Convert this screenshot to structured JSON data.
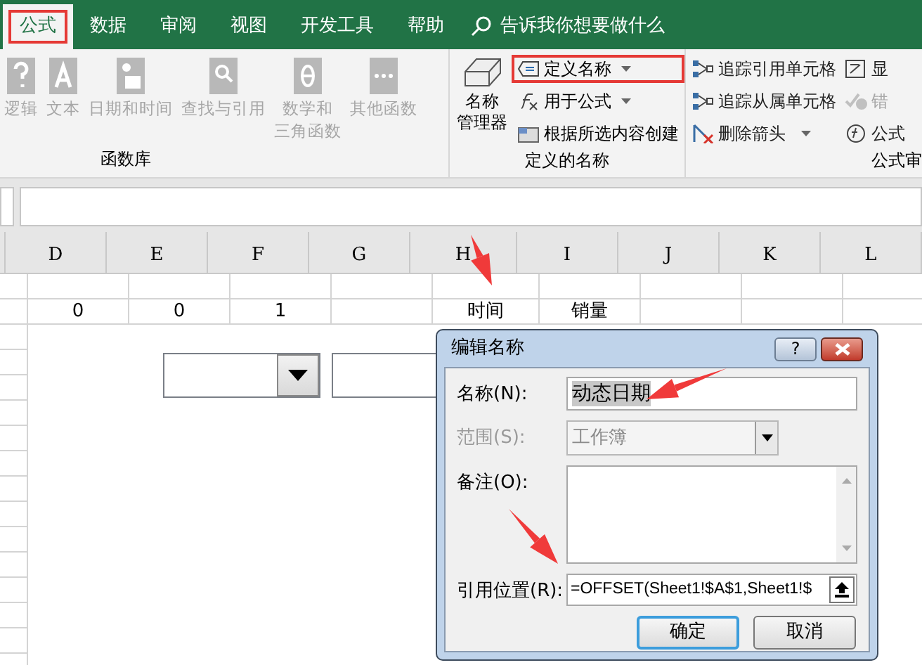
{
  "tabs": [
    {
      "label": "公式",
      "selected": true
    },
    {
      "label": "数据",
      "selected": false
    },
    {
      "label": "审阅",
      "selected": false
    },
    {
      "label": "视图",
      "selected": false
    },
    {
      "label": "开发工具",
      "selected": false
    },
    {
      "label": "帮助",
      "selected": false
    }
  ],
  "tell_me": {
    "placeholder": "告诉我你想要做什么"
  },
  "function_library": {
    "label": "函数库",
    "items": [
      {
        "label": "逻辑",
        "kind": "help",
        "disabled": true
      },
      {
        "label": "文本",
        "kind": "text",
        "disabled": true
      },
      {
        "label": "日期和时间",
        "kind": "calendar",
        "disabled": true
      },
      {
        "label": "查找与引用",
        "kind": "search",
        "disabled": true
      },
      {
        "lines": [
          "数学和",
          "三角函数"
        ],
        "kind": "theta",
        "disabled": true
      },
      {
        "label": "其他函数",
        "kind": "more",
        "disabled": true
      }
    ]
  },
  "defined_names": {
    "label": "定义的名称",
    "manager": [
      "名称",
      "管理器"
    ],
    "items": [
      {
        "label": "定义名称",
        "kind": "define",
        "highlighted": true,
        "dropdown": true
      },
      {
        "label": "用于公式",
        "kind": "fx",
        "highlighted": false,
        "dropdown": true
      },
      {
        "label": "根据所选内容创建",
        "kind": "create",
        "highlighted": false,
        "dropdown": false
      }
    ]
  },
  "formula_auditing": {
    "label": "公式审",
    "items": [
      {
        "label": "追踪引用单元格",
        "kind": "precedents",
        "disabled": false
      },
      {
        "label": "追踪从属单元格",
        "kind": "dependents",
        "disabled": false
      },
      {
        "label": "删除箭头",
        "kind": "remove",
        "disabled": false
      }
    ],
    "side": [
      {
        "label": "显",
        "kind": "show",
        "disabled": false
      },
      {
        "label": "错",
        "kind": "error",
        "disabled": true
      },
      {
        "label": "公式",
        "kind": "eval",
        "disabled": false
      }
    ]
  },
  "columns": [
    "D",
    "E",
    "F",
    "G",
    "H",
    "I",
    "J",
    "K",
    "L"
  ],
  "rows": [
    [
      "",
      "",
      "",
      "",
      "",
      "",
      "",
      "",
      ""
    ],
    [
      "0",
      "0",
      "1",
      "",
      "时间",
      "销量",
      "",
      "",
      ""
    ]
  ],
  "dialog": {
    "title": "编辑名称",
    "help": "?",
    "fields": [
      {
        "label": "名称(N):",
        "kind": "text",
        "value": "动态日期",
        "disabled": false
      },
      {
        "label": "范围(S):",
        "kind": "select",
        "value": "工作簿",
        "disabled": true
      },
      {
        "label": "备注(O):",
        "kind": "textarea",
        "disabled": false
      },
      {
        "label": "引用位置(R):",
        "kind": "ref",
        "value": "=OFFSET(Sheet1!$A$1,Sheet1!$",
        "disabled": false
      }
    ],
    "buttons": [
      {
        "label": "确定",
        "default": true
      },
      {
        "label": "取消",
        "default": false
      }
    ]
  }
}
